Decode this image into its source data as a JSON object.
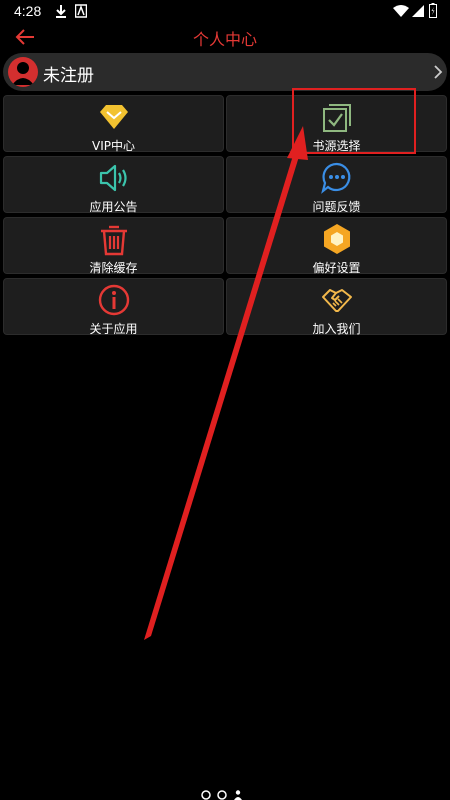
{
  "status_bar": {
    "time": "4:28"
  },
  "app_bar": {
    "title": "个人中心"
  },
  "profile": {
    "name": "未注册"
  },
  "menu": [
    {
      "label": "VIP中心",
      "icon": "vip-diamond-icon"
    },
    {
      "label": "书源选择",
      "icon": "book-source-check-icon"
    },
    {
      "label": "应用公告",
      "icon": "speaker-icon"
    },
    {
      "label": "问题反馈",
      "icon": "chat-bubble-icon"
    },
    {
      "label": "清除缓存",
      "icon": "trash-icon"
    },
    {
      "label": "偏好设置",
      "icon": "hexagon-settings-icon"
    },
    {
      "label": "关于应用",
      "icon": "info-icon"
    },
    {
      "label": "加入我们",
      "icon": "handshake-icon"
    }
  ],
  "colors": {
    "accent": "#e53935",
    "tile_bg": "#1e1e1e",
    "profile_bg": "#2b2b2b",
    "annotation": "#e02020"
  }
}
